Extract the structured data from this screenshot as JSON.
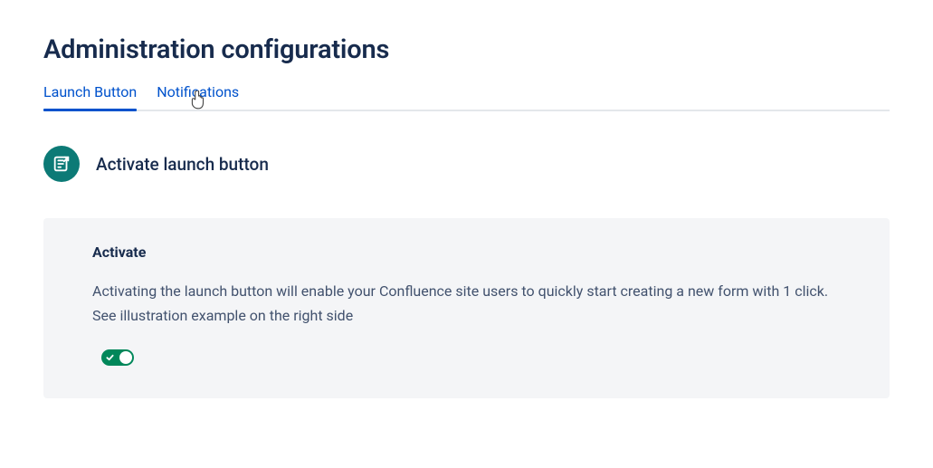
{
  "page": {
    "title": "Administration configurations"
  },
  "tabs": [
    {
      "label": "Launch Button",
      "active": true
    },
    {
      "label": "Notifications",
      "active": false
    }
  ],
  "section": {
    "title": "Activate launch button",
    "icon": "form-launch-icon"
  },
  "card": {
    "title": "Activate",
    "body": "Activating the launch button will enable your Confluence site users to quickly start creating a new form with 1 click. See illustration example on the right side",
    "toggle": {
      "state": "on"
    }
  }
}
